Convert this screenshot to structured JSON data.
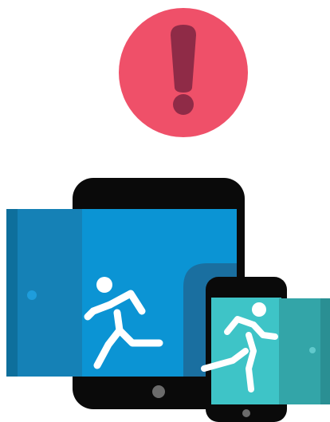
{
  "illustration": {
    "alert_icon": "exclamation-mark-icon",
    "tablet_icon": "running-person-exit-icon",
    "phone_icon": "running-person-exit-icon",
    "door_icon": "open-door-icon"
  },
  "colors": {
    "background": "#ffffff",
    "alert_circle": "#ef5069",
    "alert_mark": "#8f2b47",
    "device_body": "#0a0a0a",
    "tablet_screen": "#0b94d4",
    "tablet_door_outer": "#0e6f9c",
    "tablet_door_panel": "#1581b6",
    "phone_screen": "#3ec4c7",
    "phone_door_outer": "#2a8f93",
    "phone_door_panel": "#33a5a8",
    "door_knob": "#1e9ddc",
    "figure": "#ffffff",
    "home_button": "#6b6b6b"
  }
}
